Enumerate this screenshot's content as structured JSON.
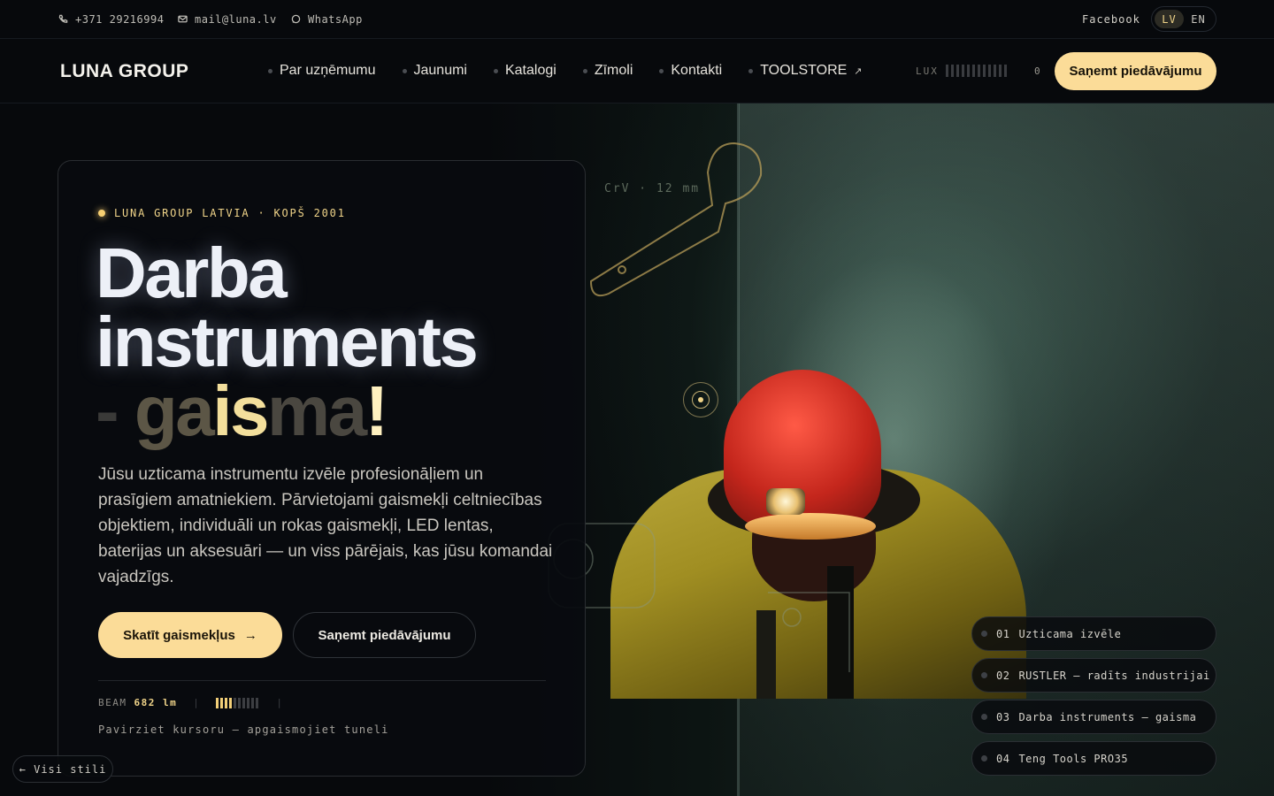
{
  "topbar": {
    "phone": "+371 29216994",
    "email": "mail@luna.lv",
    "whatsapp": "WhatsApp",
    "facebook": "Facebook",
    "lang_lv": "LV",
    "lang_en": "EN",
    "active_lang": "LV"
  },
  "nav": {
    "logo": "LUNA GROUP",
    "items": [
      {
        "label": "Par uzņēmumu"
      },
      {
        "label": "Jaunumi"
      },
      {
        "label": "Katalogi"
      },
      {
        "label": "Zīmoli"
      },
      {
        "label": "Kontakti"
      },
      {
        "label": "TOOLSTORE",
        "external_icon": "↗"
      }
    ],
    "lux_label": "LUX",
    "lux_value": "0",
    "cta": "Saņemt piedāvājumu"
  },
  "hero": {
    "eyebrow": "LUNA GROUP LATVIA · KOPŠ 2001",
    "title_line1": "Darba",
    "title_line2": "instruments",
    "title_line3": "- gaisma!",
    "lead": "Jūsu uzticama instrumentu izvēle profesionāļiem un prasīgiem amatniekiem. Pārvietojami gaismekļi celtniecības objektiem, individuāli un rokas gaismekļi, LED lentas, baterijas un aksesuāri — un viss pārējais, kas jūsu komandai vajadzīgs.",
    "primary_button": "Skatīt gaismekļus",
    "primary_arrow": "→",
    "secondary_button": "Saņemt piedāvājumu",
    "beam_label": "BEAM",
    "beam_value": "682 lm",
    "beam_level": 0.4,
    "hint": "Pavirziet kursoru — apgaismojiet tuneli",
    "overlay_label": "CrV · 12 mm"
  },
  "features": [
    {
      "num": "01",
      "label": "Uzticama izvēle"
    },
    {
      "num": "02",
      "label": "RUSTLER – radīts industrijai"
    },
    {
      "num": "03",
      "label": "Darba instruments – gaisma"
    },
    {
      "num": "04",
      "label": "Teng Tools PRO35"
    }
  ],
  "back_link": "← Visi stili",
  "colors": {
    "accent": "#fbdc98",
    "gold": "#f0d489",
    "background": "#07090c"
  }
}
